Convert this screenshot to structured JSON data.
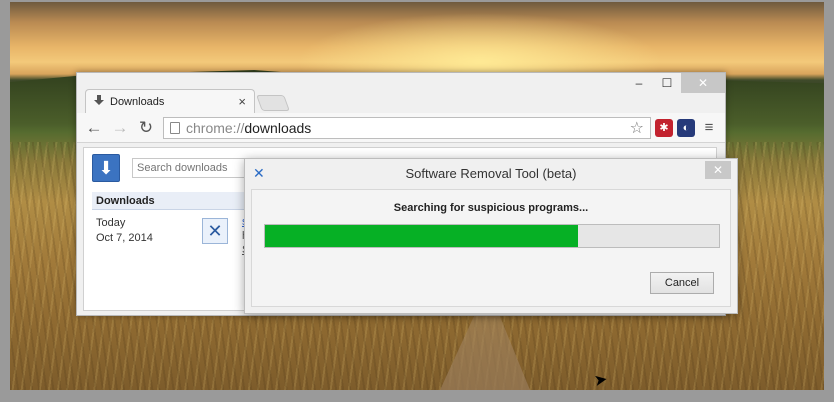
{
  "chrome": {
    "tab_title": "Downloads",
    "tab_close": "×",
    "url_scheme": "chrome://",
    "url_host": "downloads",
    "window_controls": {
      "minimize": "–",
      "maximize": "☐",
      "close": "✕"
    },
    "icons": {
      "back": "arrow-left-icon",
      "forward": "arrow-right-icon",
      "reload": "reload-icon",
      "star": "star-icon",
      "extension_1": "red-extension-icon",
      "extension_2": "blue-extension-icon",
      "menu": "hamburger-menu-icon"
    }
  },
  "downloads_page": {
    "search_placeholder": "Search downloads",
    "heading": "Downloads",
    "entries": [
      {
        "date_1": "Today",
        "date_2": "Oct 7, 2014"
      }
    ],
    "peek_lines": [
      "s",
      "h",
      "S"
    ]
  },
  "dialog": {
    "title": "Software Removal Tool (beta)",
    "close": "✕",
    "status": "Searching for suspicious programs...",
    "progress": 0.69,
    "cancel_label": "Cancel",
    "colors": {
      "progress_fill": "#06b025"
    }
  }
}
